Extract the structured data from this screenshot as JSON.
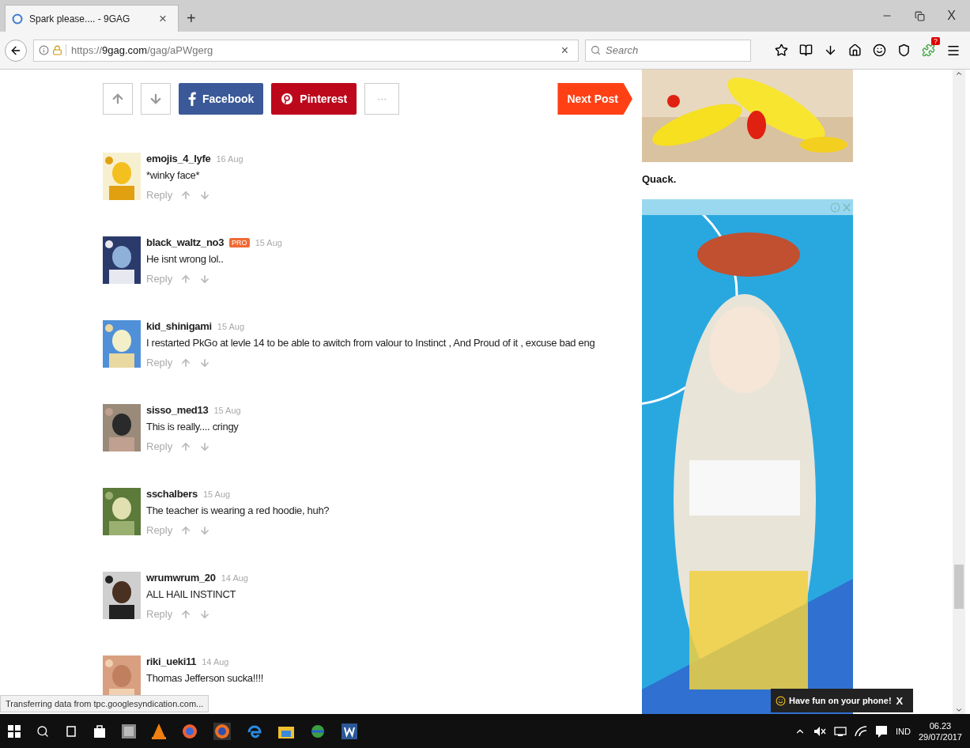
{
  "browser": {
    "tab_title": "Spark please.... - 9GAG",
    "tab_close": "×",
    "new_tab": "+",
    "url_prefix": "https://",
    "url_host": "9gag.com",
    "url_path": "/gag/aPWgerg",
    "url_clear": "×",
    "search": {
      "placeholder": "Search"
    },
    "extension_badge": "?",
    "window_close": "X"
  },
  "share_bar": {
    "facebook": "Facebook",
    "pinterest": "Pinterest",
    "more": "···",
    "next": "Next Post"
  },
  "comments": [
    {
      "user": "emojis_4_lyfe",
      "date": "16 Aug",
      "text": "*winky face*",
      "reply": "Reply"
    },
    {
      "user": "black_waltz_no3",
      "badge": "PRO",
      "date": "15 Aug",
      "text": "He isnt wrong lol..",
      "reply": "Reply"
    },
    {
      "user": "kid_shinigami",
      "date": "15 Aug",
      "text": "I restarted PkGo at levle 14 to be able to awitch from valour to Instinct , And Proud of it , excuse bad eng",
      "reply": "Reply"
    },
    {
      "user": "sisso_med13",
      "date": "15 Aug",
      "text": "This is really.... cringy",
      "reply": "Reply"
    },
    {
      "user": "sschalbers",
      "date": "15 Aug",
      "text": "The teacher is wearing a red hoodie, huh?",
      "reply": "Reply"
    },
    {
      "user": "wrumwrum_20",
      "date": "14 Aug",
      "text": "ALL HAIL INSTINCT",
      "reply": "Reply"
    },
    {
      "user": "riki_ueki11",
      "date": "14 Aug",
      "text": "Thomas Jefferson sucka!!!!"
    }
  ],
  "sidebar": {
    "caption": "Quack."
  },
  "status": "Transferring data from tpc.googlesyndication.com...",
  "toast": {
    "text": "Have fun on your phone!",
    "close": "X"
  },
  "taskbar": {
    "language": "IND",
    "time": "06.23",
    "date": "29/07/2017"
  }
}
